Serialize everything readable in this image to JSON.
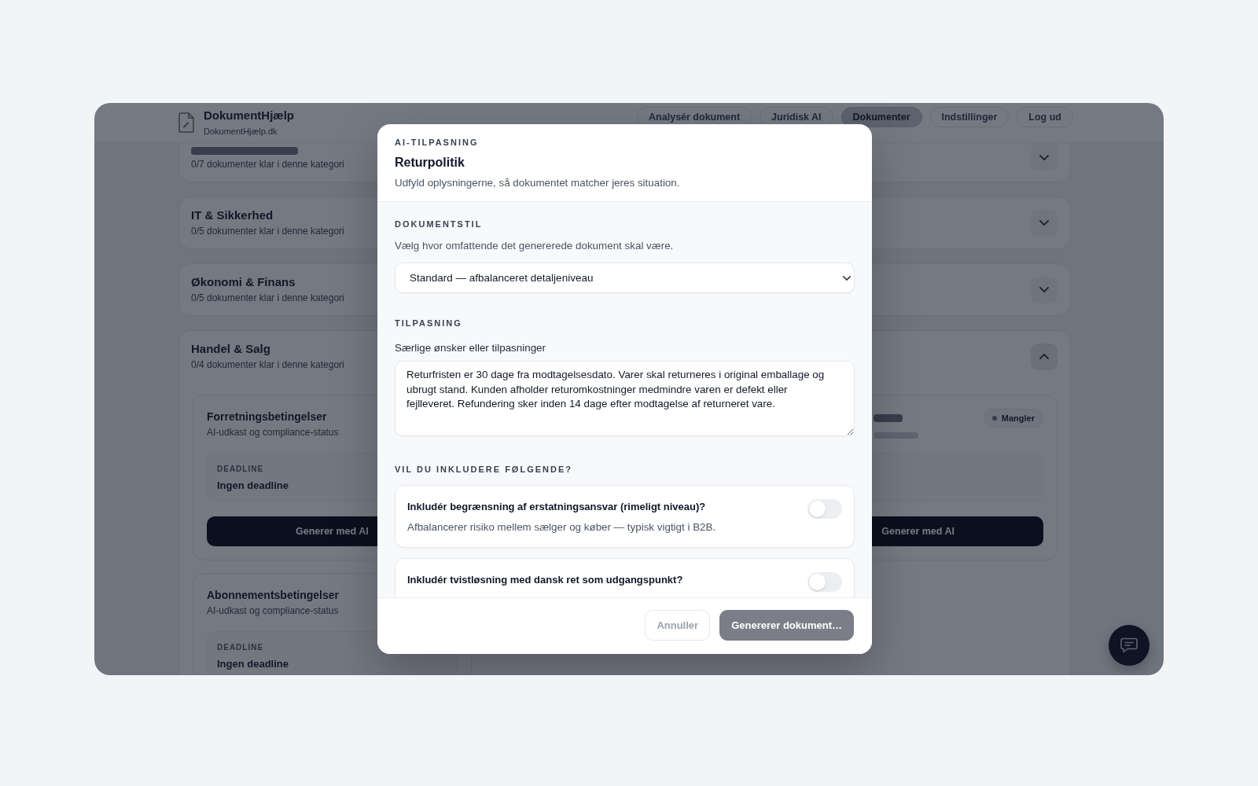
{
  "header": {
    "brand": "DokumentHjælp",
    "domain": "DokumentHjælp.dk",
    "nav": [
      {
        "label": "Analysér dokument",
        "selected": false
      },
      {
        "label": "Juridisk AI",
        "selected": false
      },
      {
        "label": "Dokumenter",
        "selected": true
      },
      {
        "label": "Indstillinger",
        "selected": false
      },
      {
        "label": "Log ud",
        "selected": false
      }
    ]
  },
  "categories": [
    {
      "subtitle": "0/7 dokumenter klar i denne kategori",
      "expanded": false
    },
    {
      "title": "IT & Sikkerhed",
      "subtitle": "0/5 dokumenter klar i denne kategori",
      "expanded": false
    },
    {
      "title": "Økonomi & Finans",
      "subtitle": "0/5 dokumenter klar i denne kategori",
      "expanded": false
    },
    {
      "title": "Handel & Salg",
      "subtitle": "0/4 dokumenter klar i denne kategori",
      "expanded": true,
      "documents": [
        {
          "title": "Forretningsbetingelser",
          "subtitle": "AI-udkast og compliance-status",
          "deadline_label": "DEADLINE",
          "deadline": "Ingen deadline",
          "action": "Generer med AI"
        },
        {
          "badge": "Mangler",
          "action": "Generer med AI"
        },
        {
          "title": "Abonnementsbetingelser",
          "subtitle": "AI-udkast og compliance-status",
          "deadline_label": "DEADLINE",
          "deadline": "Ingen deadline"
        }
      ]
    }
  ],
  "modal": {
    "eyebrow": "AI-TILPASNING",
    "title": "Returpolitik",
    "description": "Udfyld oplysningerne, så dokumentet matcher jeres situation.",
    "style_section": {
      "heading": "DOKUMENTSTIL",
      "hint": "Vælg hvor omfattende det genererede dokument skal være.",
      "value": "Standard — afbalanceret detaljeniveau"
    },
    "custom_section": {
      "heading": "TILPASNING",
      "label": "Særlige ønsker eller tilpasninger",
      "value": "Returfristen er 30 dage fra modtagelsesdato. Varer skal returneres i original emballage og ubrugt stand. Kunden afholder returomkostninger medmindre varen er defekt eller fejlleveret. Refundering sker inden 14 dage efter modtagelse af returneret vare."
    },
    "options_section": {
      "heading": "VIL DU INKLUDERE FØLGENDE?",
      "options": [
        {
          "title": "Inkludér begrænsning af erstatningsansvar (rimeligt niveau)?",
          "description": "Afbalancerer risiko mellem sælger og køber — typisk vigtigt i B2B.",
          "on": false
        },
        {
          "title": "Inkludér tvistløsning med dansk ret som udgangspunkt?",
          "on": false
        }
      ]
    },
    "buttons": [
      {
        "label": "Annuller",
        "kind": "secondary",
        "disabled": true
      },
      {
        "label": "Genererer dokument…",
        "kind": "primary",
        "disabled": true
      }
    ]
  }
}
